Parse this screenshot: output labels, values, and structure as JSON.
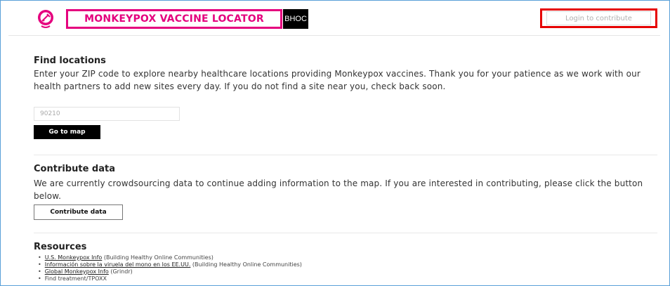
{
  "header": {
    "logo_icon": "syringe-logo-icon",
    "title": "MONKEYPOX VACCINE LOCATOR",
    "partner": "BHOC",
    "login_label": "Login to contribute",
    "colors": {
      "brand": "#e5007e",
      "login_border": "#e60000"
    }
  },
  "find": {
    "heading": "Find locations",
    "description": "Enter your ZIP code to explore nearby healthcare locations providing Monkeypox vaccines. Thank you for your patience as we work with our health partners to add new sites every day. If you do not find a site near you, check back soon.",
    "zip_placeholder": "90210",
    "go_label": "Go to map"
  },
  "contribute": {
    "heading": "Contribute data",
    "description": "We are currently crowdsourcing data to continue adding information to the map. If you are interested in contributing, please click the button below.",
    "button_label": "Contribute data"
  },
  "resources": {
    "heading": "Resources",
    "items": [
      {
        "link": "U.S. Monkeypox Info",
        "source": " (Building Healthy Online Communities)"
      },
      {
        "link": "Información sobre la viruela del mono en los EE.UU.",
        "source": " (Building Healthy Online Communities)"
      },
      {
        "link": "Global Monkeypox Info",
        "source": " (Grindr)"
      },
      {
        "link": "",
        "text": "Find treatment/TPOXX"
      }
    ]
  }
}
